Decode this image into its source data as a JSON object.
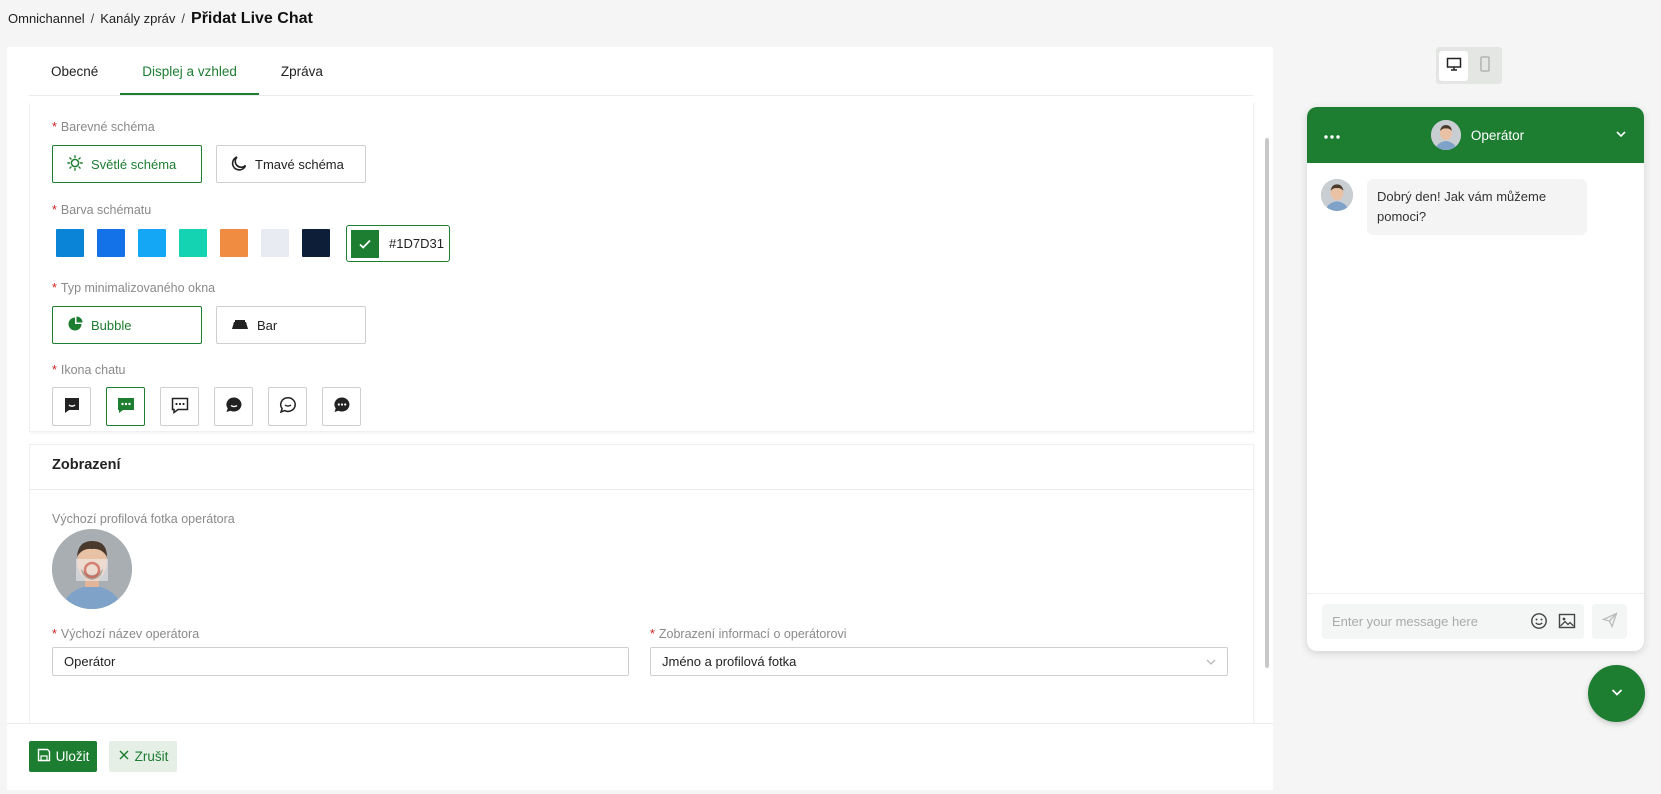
{
  "breadcrumb": {
    "items": [
      "Omnichannel",
      "Kanály zpráv"
    ],
    "separator": "/",
    "current": "Přidat Live Chat"
  },
  "tabs": [
    {
      "label": "Obecné",
      "active": false
    },
    {
      "label": "Displej a vzhled",
      "active": true
    },
    {
      "label": "Zpráva",
      "active": false
    }
  ],
  "color_scheme": {
    "label": "Barevné schéma",
    "options": [
      {
        "label": "Světlé schéma",
        "icon": "sun-icon",
        "selected": true
      },
      {
        "label": "Tmavé schéma",
        "icon": "moon-icon",
        "selected": false
      }
    ]
  },
  "scheme_color": {
    "label": "Barva schématu",
    "swatches": [
      "#0A84D6",
      "#1472E8",
      "#14A7F5",
      "#13D3B2",
      "#F08C42",
      "#E9EBF3",
      "#0D1E38"
    ],
    "custom_value": "#1D7D31",
    "custom_label": "#1D7D31"
  },
  "minimized_type": {
    "label": "Typ minimalizovaného okna",
    "options": [
      {
        "label": "Bubble",
        "icon": "bubble-icon",
        "selected": true
      },
      {
        "label": "Bar",
        "icon": "bar-icon",
        "selected": false
      }
    ]
  },
  "chat_icon": {
    "label": "Ikona chatu",
    "icons": [
      "chat-square-smile-icon",
      "chat-square-dots-icon",
      "chat-square-outline-dots-icon",
      "chat-round-filled-icon",
      "chat-round-smile-icon",
      "chat-round-dots-icon"
    ],
    "selected_index": 1
  },
  "display_section": {
    "title": "Zobrazení",
    "photo_label": "Výchozí profilová fotka operátora",
    "name_label": "Výchozí název operátora",
    "name_value": "Operátor",
    "info_label": "Zobrazení informací o operátorovi",
    "info_value": "Jméno a profilová fotka"
  },
  "footer": {
    "save_label": "Uložit",
    "cancel_label": "Zrušit"
  },
  "preview": {
    "operator_name": "Operátor",
    "greeting": "Dobrý den! Jak vám můžeme pomoci?",
    "input_placeholder": "Enter your message here"
  },
  "colors": {
    "accent": "#1D7D31",
    "required": "#d21e1e"
  }
}
